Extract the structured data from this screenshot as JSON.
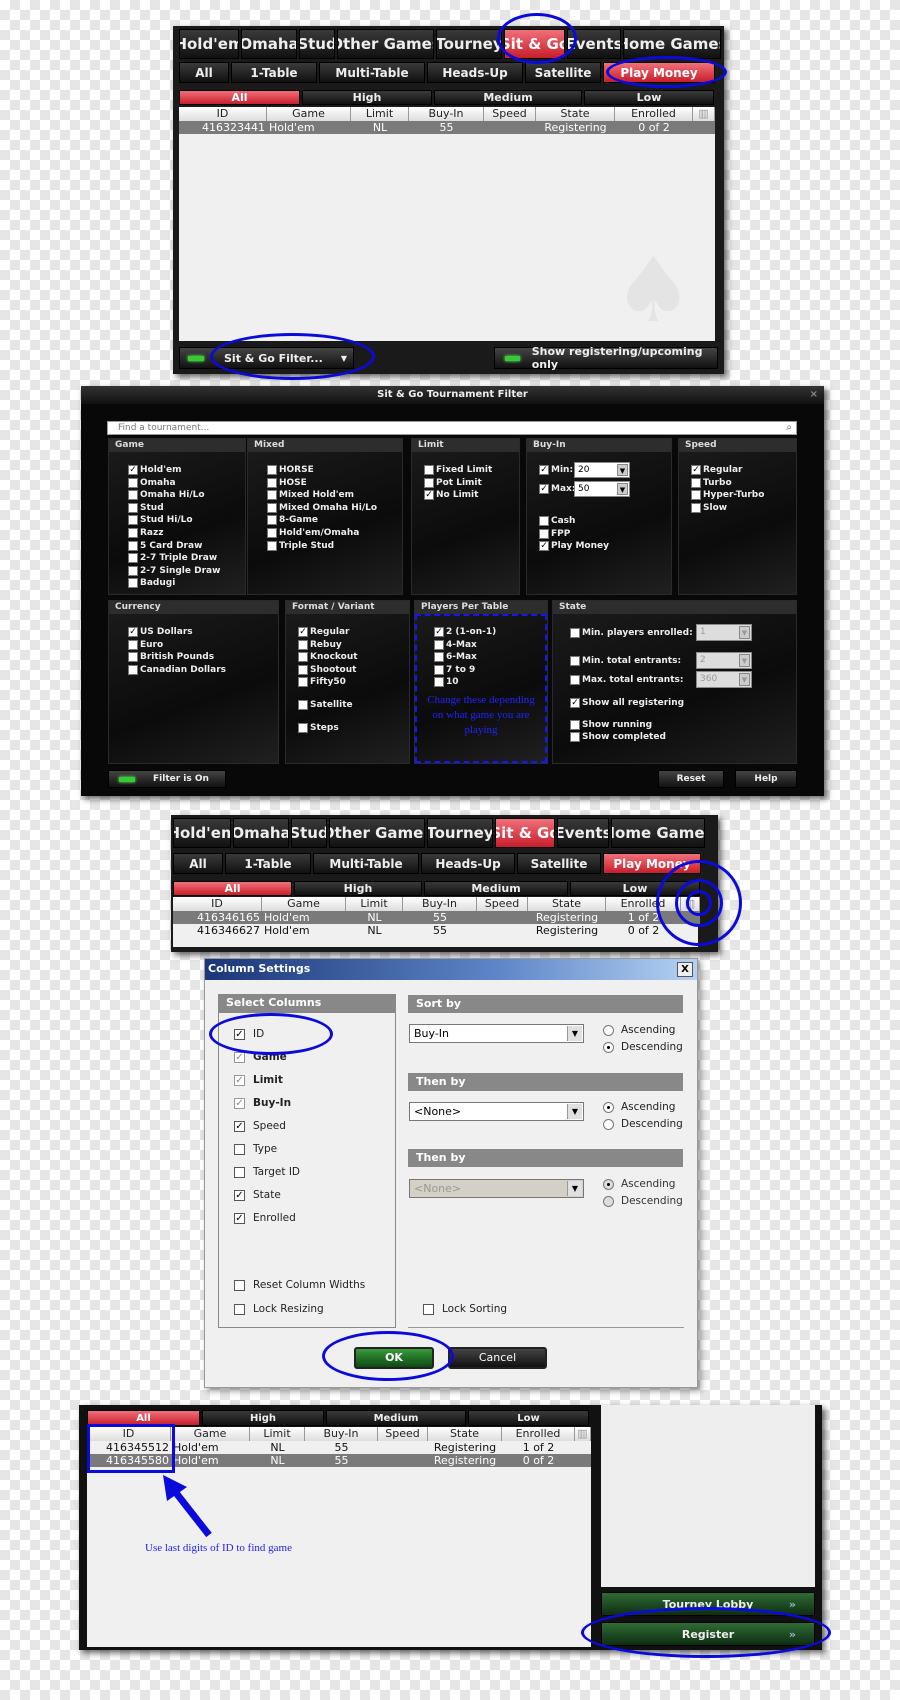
{
  "colors": {
    "accent_red": "#d42a35",
    "annotation_blue": "#0a0adc",
    "ok_green": "#1c6b24"
  },
  "lobby1": {
    "game_tabs": [
      "Hold'em",
      "Omaha",
      "Stud",
      "Other Games",
      "Tourney",
      "Sit & Go",
      "Events",
      "Home Games"
    ],
    "active_game_tab": "Sit & Go",
    "type_tabs": [
      "All",
      "1-Table",
      "Multi-Table",
      "Heads-Up",
      "Satellite",
      "Play Money"
    ],
    "active_type_tab": "Play Money",
    "stake_tabs": [
      "All",
      "High",
      "Medium",
      "Low"
    ],
    "active_stake_tab": "All",
    "columns": [
      "ID",
      "Game",
      "Limit",
      "Buy-In",
      "Speed",
      "State",
      "Enrolled"
    ],
    "sort_column": "Buy-In",
    "rows": [
      [
        "416323441",
        "Hold'em",
        "NL",
        "55",
        "",
        "Registering",
        "0 of 2"
      ]
    ],
    "filter_button": "Sit & Go Filter...",
    "show_registering_button": "Show registering/upcoming only"
  },
  "filter": {
    "title": "Sit & Go Tournament Filter",
    "search_placeholder": "Find a tournament...",
    "sections": {
      "game": {
        "label": "Game",
        "items": [
          [
            "Hold'em",
            true
          ],
          [
            "Omaha",
            false
          ],
          [
            "Omaha Hi/Lo",
            false
          ],
          [
            "Stud",
            false
          ],
          [
            "Stud Hi/Lo",
            false
          ],
          [
            "Razz",
            false
          ],
          [
            "5 Card Draw",
            false
          ],
          [
            "2-7 Triple Draw",
            false
          ],
          [
            "2-7 Single Draw",
            false
          ],
          [
            "Badugi",
            false
          ]
        ]
      },
      "mixed": {
        "label": "Mixed",
        "items": [
          [
            "HORSE",
            false
          ],
          [
            "HOSE",
            false
          ],
          [
            "Mixed Hold'em",
            false
          ],
          [
            "Mixed Omaha Hi/Lo",
            false
          ],
          [
            "8-Game",
            false
          ],
          [
            "Hold'em/Omaha",
            false
          ],
          [
            "Triple Stud",
            false
          ]
        ]
      },
      "limit": {
        "label": "Limit",
        "items": [
          [
            "Fixed Limit",
            false
          ],
          [
            "Pot Limit",
            false
          ],
          [
            "No Limit",
            true
          ]
        ]
      },
      "buyin": {
        "label": "Buy-In",
        "min_label": "Min:",
        "min_value": "20",
        "max_label": "Max:",
        "max_value": "50",
        "items": [
          [
            "Cash",
            false
          ],
          [
            "FPP",
            false
          ],
          [
            "Play Money",
            true
          ]
        ]
      },
      "speed": {
        "label": "Speed",
        "items": [
          [
            "Regular",
            true
          ],
          [
            "Turbo",
            false
          ],
          [
            "Hyper-Turbo",
            false
          ],
          [
            "Slow",
            false
          ]
        ]
      },
      "currency": {
        "label": "Currency",
        "items": [
          [
            "US Dollars",
            true
          ],
          [
            "Euro",
            false
          ],
          [
            "British Pounds",
            false
          ],
          [
            "Canadian Dollars",
            false
          ]
        ]
      },
      "format": {
        "label": "Format / Variant",
        "items": [
          [
            "Regular",
            true
          ],
          [
            "Rebuy",
            false
          ],
          [
            "Knockout",
            false
          ],
          [
            "Shootout",
            false
          ],
          [
            "Fifty50",
            false
          ],
          [
            "Satellite",
            false
          ],
          [
            "Steps",
            false
          ]
        ]
      },
      "players": {
        "label": "Players Per Table",
        "items": [
          [
            "2 (1-on-1)",
            true
          ],
          [
            "4-Max",
            false
          ],
          [
            "6-Max",
            false
          ],
          [
            "7 to 9",
            false
          ],
          [
            "10",
            false
          ]
        ],
        "annotation": "Change these depending on what game you are playing"
      },
      "state": {
        "label": "State",
        "min_players": "Min. players enrolled:",
        "min_players_value": "1",
        "min_entrants": "Min. total entrants:",
        "min_entrants_value": "2",
        "max_entrants": "Max. total entrants:",
        "max_entrants_value": "360",
        "show_all_registering": "Show all registering",
        "show_running": "Show running",
        "show_completed": "Show completed"
      }
    },
    "filter_on_button": "Filter is On",
    "reset_button": "Reset",
    "help_button": "Help"
  },
  "lobby2": {
    "rows": [
      [
        "416346165",
        "Hold'em",
        "NL",
        "55",
        "",
        "Registering",
        "1 of 2"
      ],
      [
        "416346627",
        "Hold'em",
        "NL",
        "55",
        "",
        "Registering",
        "0 of 2"
      ]
    ]
  },
  "column_settings": {
    "title": "Column Settings",
    "close": "X",
    "select_columns": "Select Columns",
    "columns": [
      [
        "ID",
        true,
        false
      ],
      [
        "Game",
        true,
        true
      ],
      [
        "Limit",
        true,
        true
      ],
      [
        "Buy-In",
        true,
        true
      ],
      [
        "Speed",
        true,
        false
      ],
      [
        "Type",
        false,
        false
      ],
      [
        "Target ID",
        false,
        false
      ],
      [
        "State",
        true,
        false
      ],
      [
        "Enrolled",
        true,
        false
      ]
    ],
    "reset_widths": "Reset Column Widths",
    "lock_resizing": "Lock Resizing",
    "sort_by": "Sort by",
    "sort_by_value": "Buy-In",
    "then_by": "Then by",
    "then_by_value": "<None>",
    "then_by2": "Then by",
    "then_by2_value": "<None>",
    "ascending": "Ascending",
    "descending": "Descending",
    "lock_sorting": "Lock Sorting",
    "ok": "OK",
    "cancel": "Cancel"
  },
  "lobby3": {
    "rows": [
      [
        "416345512",
        "Hold'em",
        "NL",
        "55",
        "",
        "Registering",
        "1 of 2"
      ],
      [
        "416345580",
        "Hold'em",
        "NL",
        "55",
        "",
        "Registering",
        "0 of 2"
      ]
    ],
    "annotation": "Use last digits of ID to find game",
    "tourney_lobby_button": "Tourney Lobby",
    "register_button": "Register"
  }
}
